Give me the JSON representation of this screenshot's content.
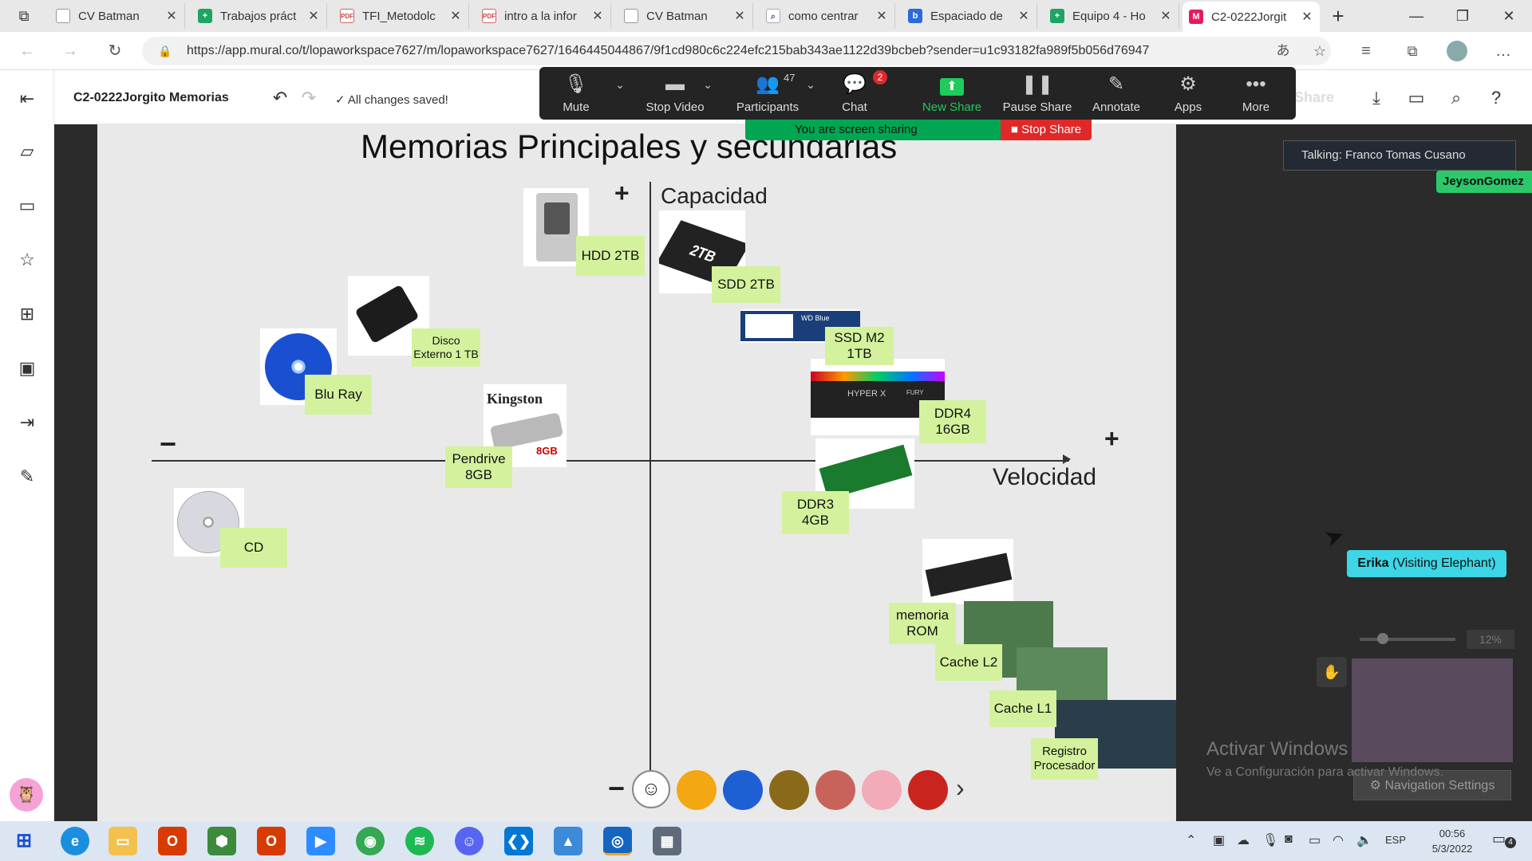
{
  "browser": {
    "tabs": [
      {
        "label": "CV Batman",
        "icon": "doc-icon"
      },
      {
        "label": "Trabajos práct",
        "icon": "sheets-icon"
      },
      {
        "label": "TFI_Metodolc",
        "icon": "pdf-icon"
      },
      {
        "label": "intro a la infor",
        "icon": "pdf-icon"
      },
      {
        "label": "CV Batman",
        "icon": "doc-icon"
      },
      {
        "label": "como centrar",
        "icon": "search-icon"
      },
      {
        "label": "Espaciado de",
        "icon": "bing-icon"
      },
      {
        "label": "Equipo 4 - Ho",
        "icon": "sheets-icon"
      },
      {
        "label": "C2-0222Jorgit",
        "icon": "mural-icon"
      }
    ],
    "new_tab": "+",
    "url": "https://app.mural.co/t/lopaworkspace7627/m/lopaworkspace7627/1646445044867/9f1cd980c6c224efc215bab343ae1122d39bcbeb?sender=u1c93182fa989f5b056d76947"
  },
  "mural": {
    "title": "C2-0222Jorgito Memorias",
    "save_status": "All changes saved!",
    "share_label": "Share"
  },
  "zoom_toolbar": {
    "mute": "Mute",
    "stop_video": "Stop Video",
    "participants": "Participants",
    "participants_count": "47",
    "chat": "Chat",
    "chat_badge": "2",
    "new_share": "New Share",
    "pause_share": "Pause Share",
    "annotate": "Annotate",
    "apps": "Apps",
    "more": "More",
    "sharing_text": "You are screen sharing",
    "stop_share": "Stop Share"
  },
  "board": {
    "title": "Memorias Principales y secundarias",
    "y_axis_label": "Capacidad",
    "x_axis_label": "Velocidad",
    "plus": "+",
    "minus": "−",
    "stickies": [
      "HDD 2TB",
      "SDD 2TB",
      "SSD M2\n1TB",
      "Disco\nExterno 1 TB",
      "Blu Ray",
      "DDR4\n16GB",
      "Pendrive\n8GB",
      "DDR3\n4GB",
      "CD",
      "memoria\nROM",
      "Cache L2",
      "Cache L1",
      "Registro\nProcesador"
    ],
    "image_texts": {
      "ssd": "2TB",
      "kingston": "Kingston",
      "pendrive_size": "8GB",
      "hyperx": "HYPER X",
      "fury": "FURY",
      "wd": "WD Blue"
    }
  },
  "overlays": {
    "talking": "Talking: Franco Tomas Cusano",
    "cursor_tag_1": "JeysonGomez",
    "cursor_tag_2_name": "Erika",
    "cursor_tag_2_suffix": " (Visiting Elephant)",
    "zoom_percent": "12%",
    "navigation_settings": "Navigation Settings",
    "activate_title": "Activar Windows",
    "activate_sub": "Ve a Configuración para activar Windows."
  },
  "taskbar": {
    "time": "00:56",
    "date": "5/3/2022",
    "lang": "ESP",
    "notif_count": "4"
  }
}
